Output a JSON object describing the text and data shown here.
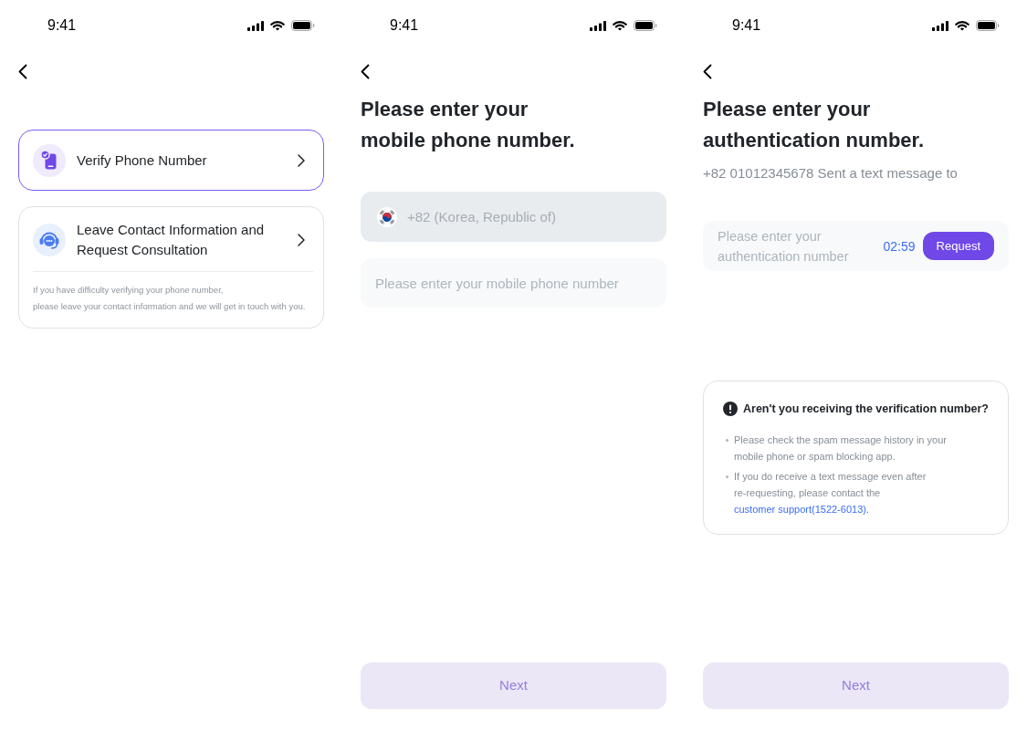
{
  "screens": [
    {
      "kind": "options",
      "status_bar": {
        "time": "9:41"
      },
      "options": [
        {
          "kind": "phone",
          "label": "Verify Phone Number",
          "selected": true
        },
        {
          "kind": "consult",
          "label": "Leave Contact Information and Request Consultation",
          "selected": false,
          "note": "If you have difficulty verifying your phone number,\nplease leave your contact information and we will get in touch with you."
        }
      ]
    },
    {
      "kind": "phone_entry",
      "status_bar": {
        "time": "9:41"
      },
      "title": "Please enter your\nmobile phone number.",
      "country_field": {
        "value": "+82 (Korea, Republic of)",
        "disabled": true
      },
      "phone_field": {
        "placeholder": "Please enter your mobile phone number"
      },
      "next_button": {
        "label": "Next",
        "disabled": true
      }
    },
    {
      "kind": "code_entry",
      "status_bar": {
        "time": "9:41"
      },
      "title": "Please enter your\nauthentication number.",
      "subtitle": "+82 01012345678 Sent a text message to",
      "code_field": {
        "placeholder": "Please enter your authentication number",
        "timer": "02:59",
        "button": "Request"
      },
      "help": {
        "title": "Aren't you receiving the verification number?",
        "items": [
          {
            "text": "Please check the spam message history in your mobile phone or spam blocking app."
          },
          {
            "text": "If you do receive a text message even after\nre-requesting, please contact the",
            "link": "customer support(1522-6013)."
          }
        ]
      },
      "next_button": {
        "label": "Next",
        "disabled": true
      }
    }
  ]
}
